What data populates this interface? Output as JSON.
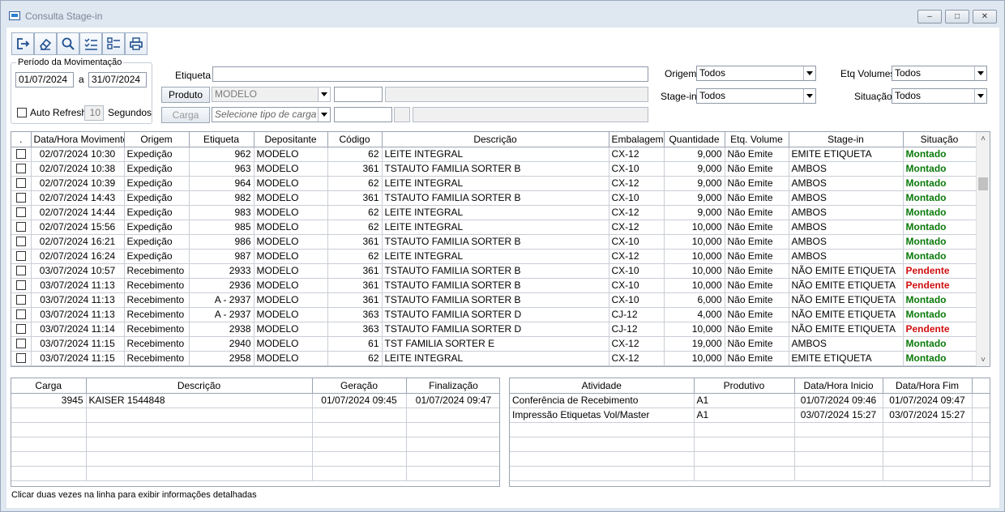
{
  "window": {
    "title": "Consulta Stage-in"
  },
  "toolbar": {
    "icons": [
      "exit-icon",
      "eraser-icon",
      "search-icon",
      "checklist-icon",
      "list-icon",
      "print-icon"
    ]
  },
  "periodo": {
    "legend": "Período da Movimentação",
    "date_from": "01/07/2024",
    "sep": "a",
    "date_to": "31/07/2024",
    "auto_refresh_label": "Auto Refresh",
    "seconds_value": "10",
    "seconds_label": "Segundos"
  },
  "filters": {
    "etiqueta_label": "Etiqueta",
    "etiqueta_value": "",
    "produto_button": "Produto",
    "produto_value": "MODELO",
    "carga_button": "Carga",
    "carga_placeholder": "Selecione tipo de carga",
    "origem_label": "Origem",
    "origem_value": "Todos",
    "stagein_label": "Stage-in",
    "stagein_value": "Todos",
    "etqvol_label": "Etq Volumes",
    "etqvol_value": "Todos",
    "situacao_label": "Situação",
    "situacao_value": "Todos"
  },
  "main_grid": {
    "columns": [
      ".",
      "Data/Hora Movimento",
      "Origem",
      "Etiqueta",
      "Depositante",
      "Código",
      "Descrição",
      "Embalagem",
      "Quantidade",
      "Etq. Volume",
      "Stage-in",
      "Situação"
    ],
    "rows": [
      [
        "02/07/2024 10:30",
        "Expedição",
        "962",
        "MODELO",
        "62",
        "LEITE INTEGRAL",
        "CX-12",
        "9,000",
        "Não Emite",
        "EMITE ETIQUETA",
        "Montado"
      ],
      [
        "02/07/2024 10:38",
        "Expedição",
        "963",
        "MODELO",
        "361",
        "TSTAUTO FAMILIA SORTER B",
        "CX-10",
        "9,000",
        "Não Emite",
        "AMBOS",
        "Montado"
      ],
      [
        "02/07/2024 10:39",
        "Expedição",
        "964",
        "MODELO",
        "62",
        "LEITE INTEGRAL",
        "CX-12",
        "9,000",
        "Não Emite",
        "AMBOS",
        "Montado"
      ],
      [
        "02/07/2024 14:43",
        "Expedição",
        "982",
        "MODELO",
        "361",
        "TSTAUTO FAMILIA SORTER B",
        "CX-10",
        "9,000",
        "Não Emite",
        "AMBOS",
        "Montado"
      ],
      [
        "02/07/2024 14:44",
        "Expedição",
        "983",
        "MODELO",
        "62",
        "LEITE INTEGRAL",
        "CX-12",
        "9,000",
        "Não Emite",
        "AMBOS",
        "Montado"
      ],
      [
        "02/07/2024 15:56",
        "Expedição",
        "985",
        "MODELO",
        "62",
        "LEITE INTEGRAL",
        "CX-12",
        "10,000",
        "Não Emite",
        "AMBOS",
        "Montado"
      ],
      [
        "02/07/2024 16:21",
        "Expedição",
        "986",
        "MODELO",
        "361",
        "TSTAUTO FAMILIA SORTER B",
        "CX-10",
        "10,000",
        "Não Emite",
        "AMBOS",
        "Montado"
      ],
      [
        "02/07/2024 16:24",
        "Expedição",
        "987",
        "MODELO",
        "62",
        "LEITE INTEGRAL",
        "CX-12",
        "10,000",
        "Não Emite",
        "AMBOS",
        "Montado"
      ],
      [
        "03/07/2024 10:57",
        "Recebimento",
        "2933",
        "MODELO",
        "361",
        "TSTAUTO FAMILIA SORTER B",
        "CX-10",
        "10,000",
        "Não Emite",
        "NÃO EMITE ETIQUETA",
        "Pendente"
      ],
      [
        "03/07/2024 11:13",
        "Recebimento",
        "2936",
        "MODELO",
        "361",
        "TSTAUTO FAMILIA SORTER B",
        "CX-10",
        "10,000",
        "Não Emite",
        "NÃO EMITE ETIQUETA",
        "Pendente"
      ],
      [
        "03/07/2024 11:13",
        "Recebimento",
        "A - 2937",
        "MODELO",
        "361",
        "TSTAUTO FAMILIA SORTER B",
        "CX-10",
        "6,000",
        "Não Emite",
        "NÃO EMITE ETIQUETA",
        "Montado"
      ],
      [
        "03/07/2024 11:13",
        "Recebimento",
        "A - 2937",
        "MODELO",
        "363",
        "TSTAUTO FAMILIA SORTER D",
        "CJ-12",
        "4,000",
        "Não Emite",
        "NÃO EMITE ETIQUETA",
        "Montado"
      ],
      [
        "03/07/2024 11:14",
        "Recebimento",
        "2938",
        "MODELO",
        "363",
        "TSTAUTO FAMILIA SORTER D",
        "CJ-12",
        "10,000",
        "Não Emite",
        "NÃO EMITE ETIQUETA",
        "Pendente"
      ],
      [
        "03/07/2024 11:15",
        "Recebimento",
        "2940",
        "MODELO",
        "61",
        "TST FAMILIA SORTER E",
        "CX-12",
        "19,000",
        "Não Emite",
        "AMBOS",
        "Montado"
      ],
      [
        "03/07/2024 11:15",
        "Recebimento",
        "2958",
        "MODELO",
        "62",
        "LEITE INTEGRAL",
        "CX-12",
        "10,000",
        "Não Emite",
        "EMITE ETIQUETA",
        "Montado"
      ]
    ]
  },
  "carga_grid": {
    "columns": [
      "Carga",
      "Descrição",
      "Geração",
      "Finalização"
    ],
    "rows": [
      [
        "3945",
        "KAISER 1544848",
        "01/07/2024 09:45",
        "01/07/2024 09:47"
      ]
    ]
  },
  "atividade_grid": {
    "columns": [
      "Atividade",
      "Produtivo",
      "Data/Hora Inicio",
      "Data/Hora Fim"
    ],
    "rows": [
      [
        "Conferência de Recebimento",
        "A1",
        "01/07/2024 09:46",
        "01/07/2024 09:47"
      ],
      [
        "Impressão Etiquetas Vol/Master",
        "A1",
        "03/07/2024 15:27",
        "03/07/2024 15:27"
      ]
    ]
  },
  "status_text": "Clicar duas vezes na linha para exibir informações detalhadas",
  "colors": {
    "montado": "#0a7a0a",
    "pendente": "#d01010"
  }
}
